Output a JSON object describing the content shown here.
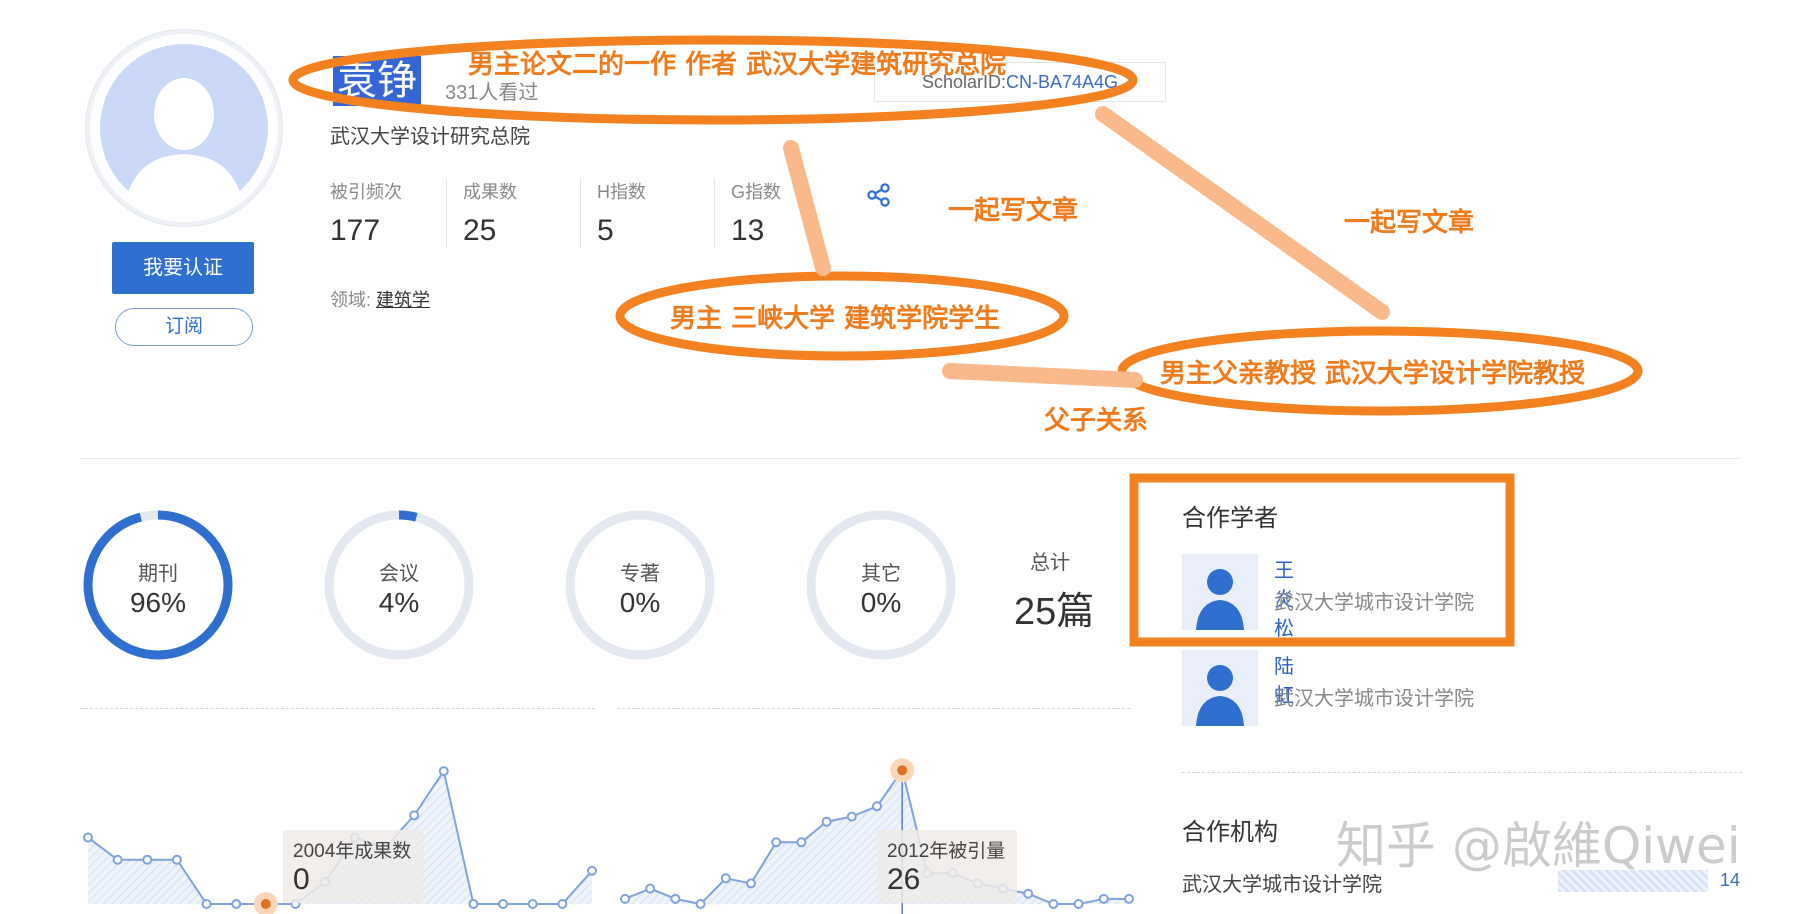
{
  "profile": {
    "name": "袁铮",
    "views": "331人看过",
    "scholar_prefix": "ScholarID:",
    "scholar_id": "CN-BA74A4G",
    "affiliation": "武汉大学设计研究总院",
    "certify_label": "我要认证",
    "subscribe_label": "订阅",
    "field_prefix": "领域:",
    "field_value": "建筑学",
    "stats": [
      {
        "label": "被引频次",
        "value": "177"
      },
      {
        "label": "成果数",
        "value": "25"
      },
      {
        "label": "H指数",
        "value": "5"
      },
      {
        "label": "G指数",
        "value": "13"
      }
    ]
  },
  "distribution": {
    "items": [
      {
        "label": "期刊",
        "value": "96%",
        "fraction": 0.96
      },
      {
        "label": "会议",
        "value": "4%",
        "fraction": 0.04
      },
      {
        "label": "专著",
        "value": "0%",
        "fraction": 0
      },
      {
        "label": "其它",
        "value": "0%",
        "fraction": 0
      }
    ],
    "total_label": "总计",
    "total_value": "25篇"
  },
  "charts": {
    "left_tooltip_title": "2004年成果数",
    "left_tooltip_value": "0",
    "right_tooltip_title": "2012年被引量",
    "right_tooltip_value": "26"
  },
  "chart_data": [
    {
      "type": "area",
      "title": "",
      "values": [
        3,
        2,
        2,
        2,
        0,
        0,
        0,
        0,
        1,
        3,
        2.5,
        4,
        6,
        0,
        0,
        0,
        0,
        1.5
      ],
      "highlight_index": 6,
      "annotation": "2004年成果数 0"
    },
    {
      "type": "area",
      "title": "",
      "values": [
        1,
        3,
        1,
        0,
        5,
        4,
        12,
        12,
        16,
        17,
        19,
        26,
        6,
        6,
        4,
        3,
        2,
        0,
        0,
        1,
        1
      ],
      "highlight_index": 11,
      "annotation": "2012年被引量 26"
    }
  ],
  "collaborators": {
    "title": "合作学者",
    "items": [
      {
        "name": "王炎松",
        "org": "武汉大学城市设计学院"
      },
      {
        "name": "陆虹",
        "org": "武汉大学城市设计学院"
      }
    ]
  },
  "institutions": {
    "title": "合作机构",
    "items": [
      {
        "name": "武汉大学城市设计学院",
        "count": "14"
      }
    ]
  },
  "annotations": {
    "top": "男主论文二的一作 作者 武汉大学建筑研究总院",
    "student": "男主 三峡大学 建筑学院学生",
    "father": "男主父亲教授 武汉大学设计学院教授",
    "write1": "一起写文章",
    "write2": "一起写文章",
    "relation": "父子关系",
    "accent": "#f07b1d"
  },
  "watermark": "知乎 @啟維Qiwei"
}
